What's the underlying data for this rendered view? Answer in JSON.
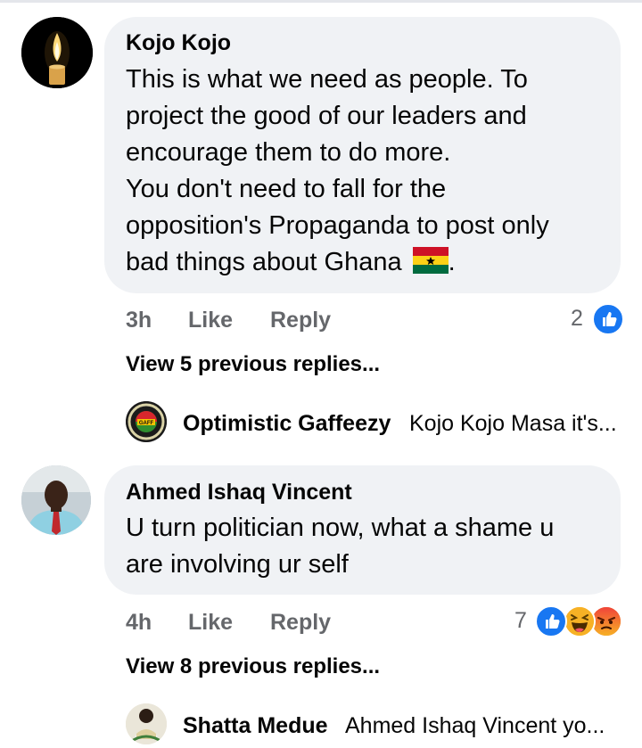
{
  "comments": [
    {
      "author": "Kojo Kojo",
      "lines": [
        "This is what we need as people. To",
        "project the good of our leaders and",
        "encourage them to do more.",
        "You don't need to fall for the",
        "opposition's Propaganda to post only",
        "bad things about Ghana"
      ],
      "last_line_suffix": ".",
      "flag_icon": "ghana-flag-icon",
      "time": "3h",
      "like_label": "Like",
      "reply_label": "Reply",
      "reaction_count": "2",
      "reactions": [
        "like"
      ],
      "view_replies": "View 5 previous replies...",
      "latest_reply": {
        "name": "Optimistic Gaffeezy",
        "snippet": "Kojo Kojo Masa it's..."
      }
    },
    {
      "author": "Ahmed Ishaq Vincent",
      "lines": [
        "U turn politician now, what a shame u",
        "are involving ur self"
      ],
      "time": "4h",
      "like_label": "Like",
      "reply_label": "Reply",
      "reaction_count": "7",
      "reactions": [
        "like",
        "haha",
        "angry"
      ],
      "view_replies": "View 8 previous replies...",
      "latest_reply": {
        "name": "Shatta Medue",
        "snippet": "Ahmed Ishaq Vincent yo..."
      }
    }
  ],
  "colors": {
    "bubble": "#f0f2f5",
    "secondary_text": "#65676b",
    "like_blue": "#1877f2",
    "haha_yellow": "#f7b125",
    "angry_orange": "#e9710f"
  }
}
